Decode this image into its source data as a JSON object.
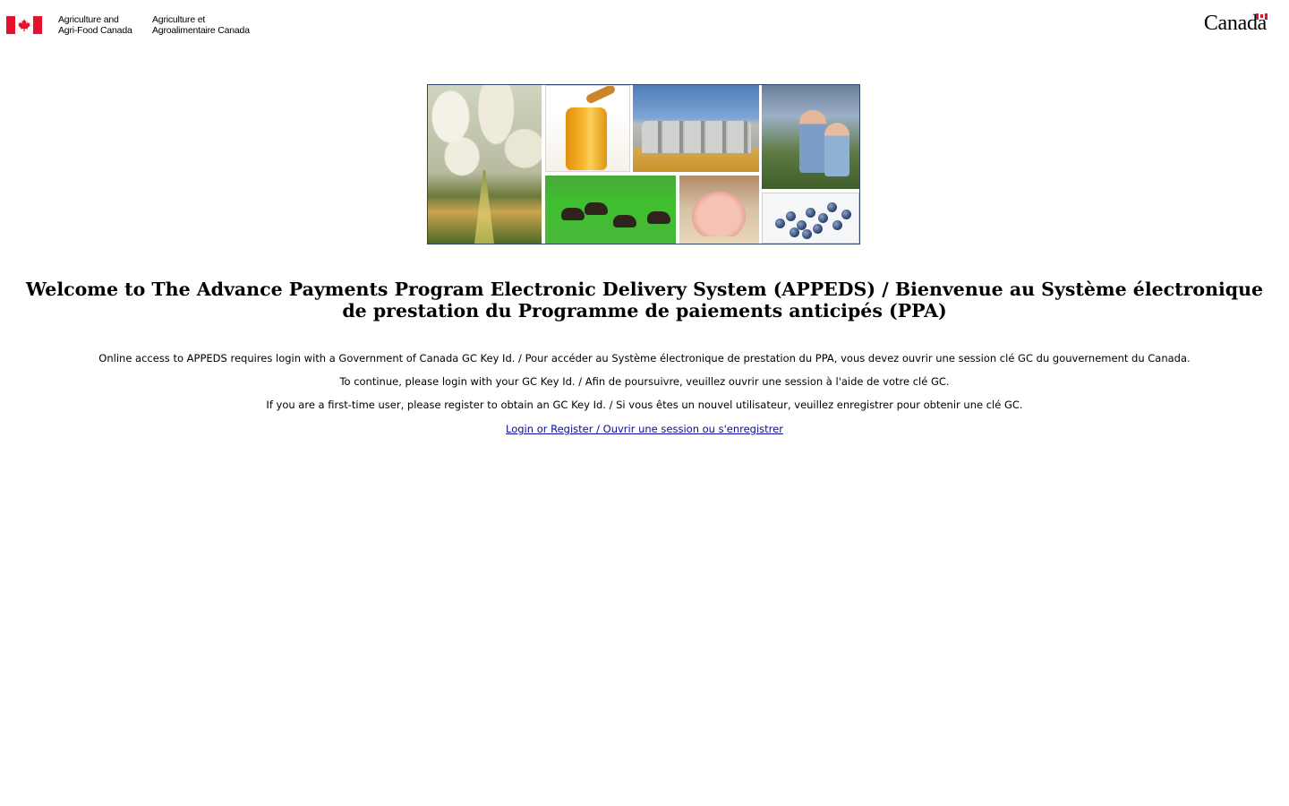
{
  "header": {
    "department_en": [
      "Agriculture and",
      "Agri-Food Canada"
    ],
    "department_fr": [
      "Agriculture et",
      "Agroalimentaire Canada"
    ],
    "wordmark": "Canada"
  },
  "banner": {
    "tiles": [
      "orchard-photo",
      "honey-jar-photo",
      "grain-silos-photo",
      "farmers-photo",
      "bison-photo",
      "piglet-photo",
      "blueberries-photo"
    ]
  },
  "main": {
    "title": "Welcome to The Advance Payments Program Electronic Delivery System (APPEDS) / Bienvenue au Système électronique de prestation du Programme de paiements anticipés (PPA)",
    "messages": [
      "Online access to APPEDS requires login with a Government of Canada GC Key Id. / Pour accéder au Système électronique de prestation du PPA, vous devez ouvrir une session clé GC du gouvernement du Canada.",
      "To continue, please login with your GC Key Id. / Afin de poursuivre, veuillez ouvrir une session à l'aide de votre clé GC.",
      "If you are a first-time user, please register to obtain an GC Key Id. / Si vous êtes un nouvel utilisateur, veuillez enregistrer pour obtenir une clé GC."
    ],
    "login_link": "Login or Register / Ouvrir une session ou s'enregistrer"
  },
  "colors": {
    "flag_red": "#e8112d",
    "link": "#0b0b9e",
    "collage_border": "#2b4a6b"
  }
}
